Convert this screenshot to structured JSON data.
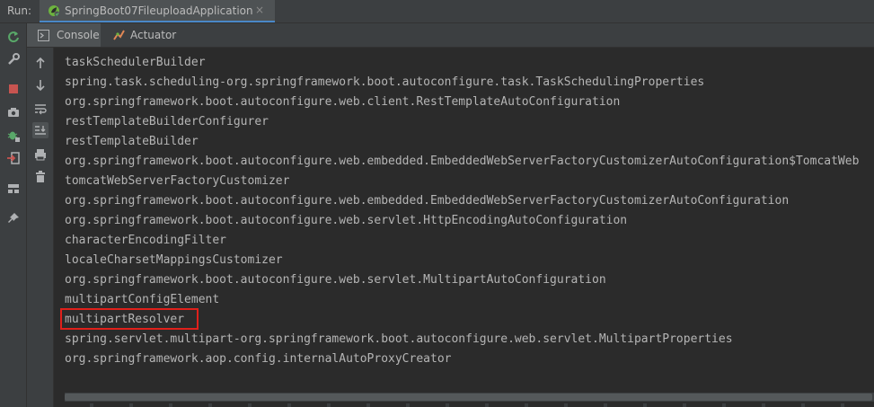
{
  "run_bar": {
    "label": "Run:",
    "tab_title": "SpringBoot07FileuploadApplication",
    "close_glyph": "×"
  },
  "sub_tabs": [
    {
      "label": "Console",
      "icon": "console-icon"
    },
    {
      "label": "Actuator",
      "icon": "actuator-icon"
    }
  ],
  "left_tools": [
    "rerun-icon",
    "wrench-icon",
    "stop-icon",
    "camera-icon",
    "debug-icon",
    "exit-icon",
    "layout-icon",
    "pin-icon"
  ],
  "console_actions": [
    "arrow-up-icon",
    "arrow-down-icon",
    "soft-wrap-icon",
    "scroll-to-end-icon",
    "print-icon",
    "trash-icon"
  ],
  "console": {
    "lines": [
      "taskSchedulerBuilder",
      "spring.task.scheduling-org.springframework.boot.autoconfigure.task.TaskSchedulingProperties",
      "org.springframework.boot.autoconfigure.web.client.RestTemplateAutoConfiguration",
      "restTemplateBuilderConfigurer",
      "restTemplateBuilder",
      "org.springframework.boot.autoconfigure.web.embedded.EmbeddedWebServerFactoryCustomizerAutoConfiguration$TomcatWeb",
      "tomcatWebServerFactoryCustomizer",
      "org.springframework.boot.autoconfigure.web.embedded.EmbeddedWebServerFactoryCustomizerAutoConfiguration",
      "org.springframework.boot.autoconfigure.web.servlet.HttpEncodingAutoConfiguration",
      "characterEncodingFilter",
      "localeCharsetMappingsCustomizer",
      "org.springframework.boot.autoconfigure.web.servlet.MultipartAutoConfiguration",
      "multipartConfigElement",
      "multipartResolver",
      "spring.servlet.multipart-org.springframework.boot.autoconfigure.web.servlet.MultipartProperties",
      "org.springframework.aop.config.internalAutoProxyCreator"
    ],
    "highlighted_line": "multipartResolver"
  },
  "colors": {
    "background": "#2b2b2b",
    "panel": "#3c3f41",
    "text": "#b5b5b5",
    "highlight_border": "#e0201b",
    "accent": "#4a88c7"
  }
}
